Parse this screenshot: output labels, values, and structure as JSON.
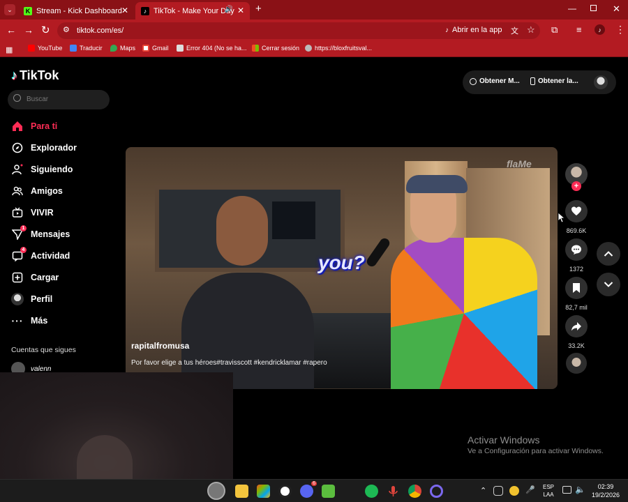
{
  "browser": {
    "tabs": [
      {
        "title": "Stream - Kick Dashboard",
        "active": false
      },
      {
        "title": "TikTok - Make Your Day",
        "active": true
      }
    ],
    "url": "tiktok.com/es/",
    "open_in_app": "Abrir en la app",
    "bookmarks": [
      "YouTube",
      "Traducir",
      "Maps",
      "Gmail",
      "Error 404 (No se ha...",
      "Cerrar sesión",
      "https://bloxfruitsval..."
    ]
  },
  "tiktok": {
    "logo": "TikTok",
    "search_placeholder": "Buscar",
    "nav": [
      {
        "label": "Para ti",
        "active": true
      },
      {
        "label": "Explorador"
      },
      {
        "label": "Siguiendo"
      },
      {
        "label": "Amigos"
      },
      {
        "label": "VIVIR"
      },
      {
        "label": "Mensajes",
        "badge": "1"
      },
      {
        "label": "Actividad",
        "badge": "4"
      },
      {
        "label": "Cargar"
      },
      {
        "label": "Perfil"
      },
      {
        "label": "Más"
      }
    ],
    "following_heading": "Cuentas que sigues",
    "following_user": "valenn",
    "header_buttons": [
      "Obtener M...",
      "Obtener la..."
    ],
    "video": {
      "watermark": "flaMe",
      "caption_overlay": "you?",
      "author": "rapitalfromusa",
      "description": "Por favor elige a tus héroes#travisscott #kendricklamar #rapero"
    },
    "rail": {
      "likes": "869.6K",
      "comments": "1372",
      "saves": "82,7 mil",
      "shares": "33.2K"
    }
  },
  "windows": {
    "activate_title": "Activar Windows",
    "activate_sub": "Ve a Configuración para activar Windows.",
    "lang": "ESP",
    "lang_sub": "LAA",
    "time": "02:39",
    "date": "19/2/2026",
    "discord_badge": "6"
  },
  "colors": {
    "accent": "#fe2c55",
    "browser_red": "#b31b22",
    "browser_dark": "#8a1116"
  }
}
